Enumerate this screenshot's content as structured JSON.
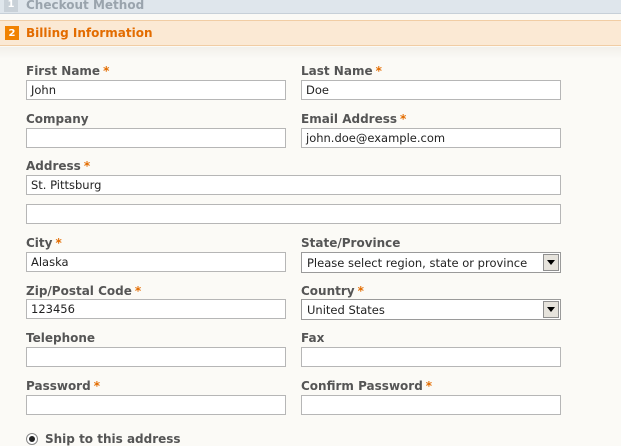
{
  "steps": [
    {
      "number": "1",
      "title": "Checkout Method"
    },
    {
      "number": "2",
      "title": "Billing Information"
    }
  ],
  "form": {
    "required_marker": "*",
    "first_name": {
      "label": "First Name",
      "value": "John"
    },
    "last_name": {
      "label": "Last Name",
      "value": "Doe"
    },
    "company": {
      "label": "Company",
      "value": ""
    },
    "email": {
      "label": "Email Address",
      "value": "john.doe@example.com"
    },
    "address": {
      "label": "Address",
      "line1": "St. Pittsburg",
      "line2": ""
    },
    "city": {
      "label": "City",
      "value": "Alaska"
    },
    "state": {
      "label": "State/Province",
      "selected": "Please select region, state or province"
    },
    "zip": {
      "label": "Zip/Postal Code",
      "value": "123456"
    },
    "country": {
      "label": "Country",
      "selected": "United States"
    },
    "telephone": {
      "label": "Telephone",
      "value": ""
    },
    "fax": {
      "label": "Fax",
      "value": ""
    },
    "password": {
      "label": "Password",
      "value": ""
    },
    "confirm_password": {
      "label": "Confirm Password",
      "value": ""
    },
    "ship_option": {
      "label": "Ship to this address",
      "checked": true
    }
  },
  "colors": {
    "accent": "#e36c00",
    "step_badge": "#f18200",
    "inactive_step": "#9aa4ad"
  }
}
